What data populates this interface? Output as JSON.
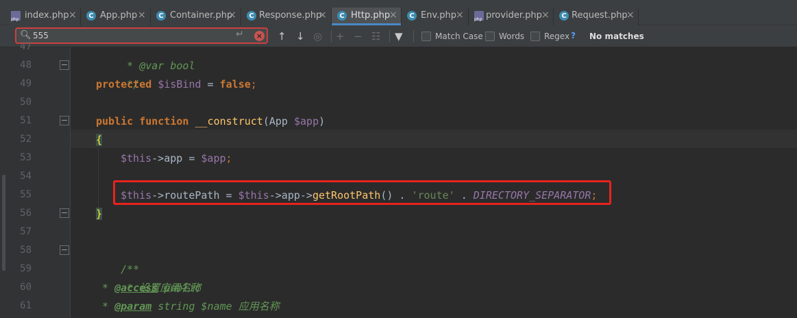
{
  "tabs": [
    {
      "label": "index.php",
      "icon": "php-file-icon",
      "active": false
    },
    {
      "label": "App.php",
      "icon": "class-icon",
      "active": false
    },
    {
      "label": "Container.php",
      "icon": "class-icon",
      "active": false
    },
    {
      "label": "Response.php",
      "icon": "class-icon",
      "active": false
    },
    {
      "label": "Http.php",
      "icon": "class-icon",
      "active": true
    },
    {
      "label": "Env.php",
      "icon": "class-icon",
      "active": false
    },
    {
      "label": "provider.php",
      "icon": "php-file-icon",
      "active": false
    },
    {
      "label": "Request.php",
      "icon": "class-icon",
      "active": false
    }
  ],
  "search": {
    "value": "555",
    "match_case_label": "Match Case",
    "words_label": "Words",
    "regex_label": "Regex",
    "help_label": "?",
    "status": "No matches"
  },
  "gutter": {
    "line_numbers": [
      "47",
      "48",
      "49",
      "50",
      "51",
      "52",
      "53",
      "54",
      "55",
      "56",
      "57",
      "58",
      "59",
      "60",
      "61"
    ]
  },
  "code": {
    "l47_partial": " * @var bool",
    "l48": " */",
    "l49_kw": "protected",
    "l49_var": "$isBind",
    "l49_eq": " = ",
    "l49_val": "false",
    "l49_semi": ";",
    "l51_kw1": "public",
    "l51_kw2": "function",
    "l51_name": "__construct",
    "l51_args_open": "(App ",
    "l51_arg": "$app",
    "l51_args_close": ")",
    "l52": "{",
    "l53_this": "$this",
    "l53_arrow": "->app = ",
    "l53_var": "$app",
    "l53_semi": ";",
    "l55_this": "$this",
    "l55_prop": "->routePath = ",
    "l55_this2": "$this",
    "l55_app": "->app->",
    "l55_call": "getRootPath",
    "l55_paren": "() . ",
    "l55_str": "'route'",
    "l55_dot": " . ",
    "l55_const": "DIRECTORY_SEPARATOR",
    "l55_semi": ";",
    "l56": "}",
    "l58": "/**",
    "l59": " * 设置应用名称",
    "l60_star": " * ",
    "l60_tag": "@access",
    "l60_rest": " public",
    "l61_star": " * ",
    "l61_tag": "@param",
    "l61_rest": " string $name 应用名称"
  },
  "colors": {
    "highlight_box": "#e8231d",
    "active_tab_underline": "#4a88c7",
    "keyword": "#cc7832",
    "variable": "#9876aa",
    "comment": "#629755",
    "string": "#6a8759",
    "method": "#ffc66d"
  }
}
